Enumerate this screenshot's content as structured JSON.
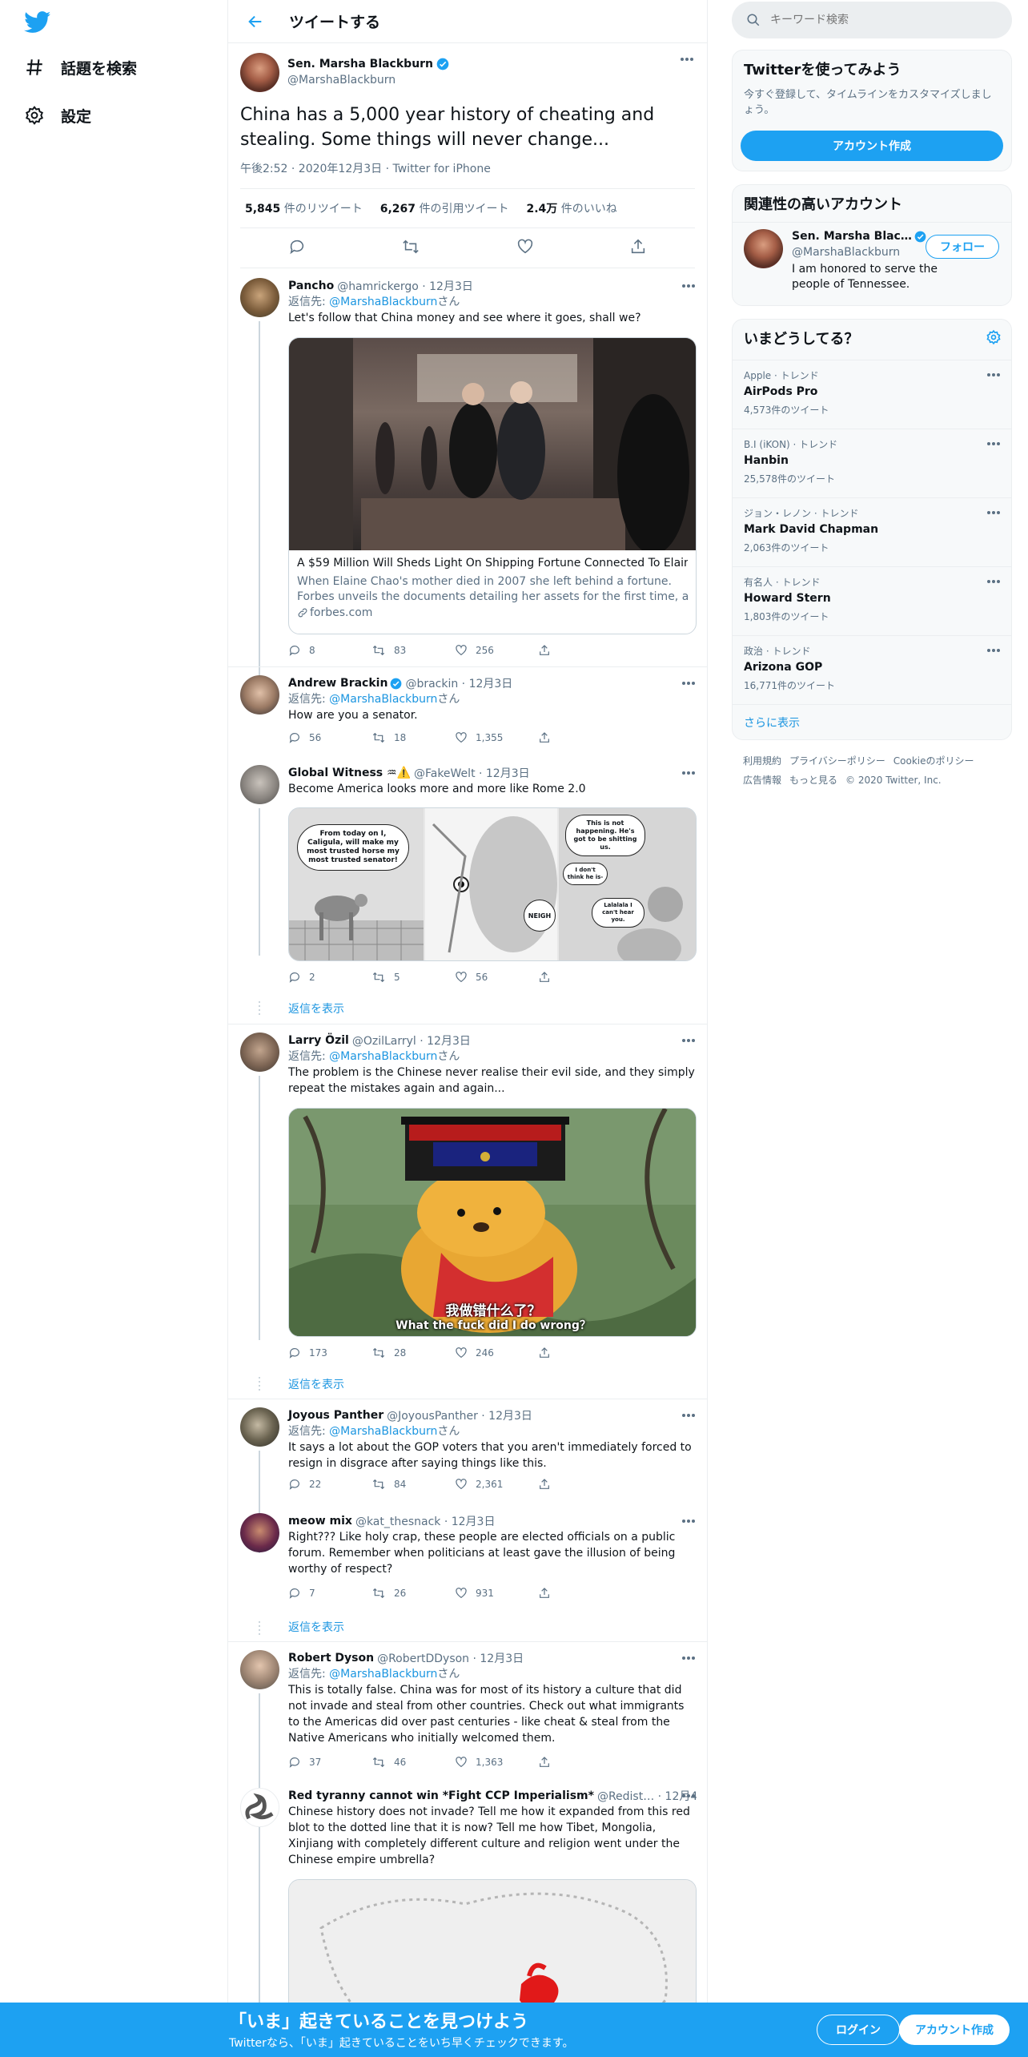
{
  "nav": {
    "items": [
      {
        "label": "話題を検索",
        "icon": "hashtag-icon"
      },
      {
        "label": "設定",
        "icon": "gear-icon"
      }
    ]
  },
  "header": {
    "title": "ツイートする"
  },
  "focal": {
    "name": "Sen. Marsha Blackburn",
    "handle": "@MarshaBlackburn",
    "text": "China has a 5,000 year history of cheating and stealing. Some things will never change...",
    "meta": "午後2:52 · 2020年12月3日 · Twitter for iPhone",
    "stats": [
      {
        "num": "5,845",
        "label": " 件のリツイート"
      },
      {
        "num": "6,267",
        "label": " 件の引用ツイート"
      },
      {
        "num": "2.4万",
        "label": " 件のいいね"
      }
    ]
  },
  "reply_prefix": "返信先: ",
  "reply_handle": "@MarshaBlackburn",
  "reply_suffix": "さん",
  "show_replies": "返信を表示",
  "tweets": [
    {
      "name": "Pancho",
      "handle": "@hamrickergo · 12月3日",
      "text": "Let's follow that China money and see where it goes, shall we?",
      "replies": "8",
      "retweets": "83",
      "likes": "256",
      "card": {
        "title": "A $59 Million Will Sheds Light On Shipping Fortune Connected To Elain…",
        "desc1": "When Elaine Chao's mother died in 2007 she left behind a fortune.",
        "desc2": "Forbes unveils the documents detailing her assets for the first time, as…",
        "domain": "forbes.com"
      }
    },
    {
      "name": "Andrew Brackin",
      "handle": "@brackin · 12月3日",
      "text": "How are you a senator.",
      "replies": "56",
      "retweets": "18",
      "likes": "1,355"
    },
    {
      "name": "Global Witness ♒⚠️",
      "handle": "@FakeWelt · 12月3日",
      "text": "Become America looks more and more like Rome 2.0",
      "replies": "2",
      "retweets": "5",
      "likes": "56",
      "comic": {
        "b1": "From today on I, Caligula, will make my most trusted horse my most trusted senator!",
        "b2": "NEIGH",
        "b3": "This is not happening. He's got to be shitting us.",
        "b4": "I don't think he is-",
        "b5": "Lalalala I can't hear you."
      }
    },
    {
      "name": "Larry Özil",
      "handle": "@OzilLarryl · 12月3日",
      "text": "The problem is the Chinese never realise their evil side, and they simply repeat the mistakes again and again...",
      "replies": "173",
      "retweets": "28",
      "likes": "246",
      "meme": {
        "cn": "我做错什么了？",
        "en": "What the fuck did I do wrong？"
      }
    },
    {
      "name": "Joyous Panther",
      "handle": "@JoyousPanther · 12月3日",
      "text": "It says a lot about the GOP voters that you aren't immediately forced to resign in disgrace after saying things like this.",
      "replies": "22",
      "retweets": "84",
      "likes": "2,361"
    },
    {
      "name": "meow mix",
      "handle": "@kat_thesnack · 12月3日",
      "text": "Right??? Like holy crap, these people are elected officials on a public forum. Remember when politicians at least gave the illusion of being worthy of respect?",
      "replies": "7",
      "retweets": "26",
      "likes": "931"
    },
    {
      "name": "Robert Dyson",
      "handle": "@RobertDDyson · 12月3日",
      "text": "This is totally false. China was for most of its history a culture that did not invade and steal from other countries. Check out what immigrants to the Americas did over past centuries - like cheat & steal from the Native Americans who initially welcomed them.",
      "replies": "37",
      "retweets": "46",
      "likes": "1,363"
    },
    {
      "name": "Red tyranny cannot win *Fight CCP Imperialism*",
      "handle": "@Redist… · 12月4日",
      "text": "Chinese history does not invade? Tell me how  it expanded from this red blot to the dotted line that it is now? Tell me how Tibet, Mongolia, Xinjiang with completely different culture and religion went under the Chinese empire umbrella?"
    }
  ],
  "sidebar": {
    "search_placeholder": "キーワード検索",
    "signup_box": {
      "title": "Twitterを使ってみよう",
      "sub": "今すぐ登録して、タイムラインをカスタマイズしましょう。",
      "button": "アカウント作成"
    },
    "related": {
      "title": "関連性の高いアカウント",
      "name": "Sen. Marsha Blac…",
      "handle": "@MarshaBlackburn",
      "follow": "フォロー",
      "bio": "I am honored to serve the people of Tennessee."
    },
    "trends_title": "いまどうしてる？",
    "trends": [
      {
        "ctx": "Apple · トレンド",
        "name": "AirPods Pro",
        "count": "4,573件のツイート"
      },
      {
        "ctx": "B.I (iKON) · トレンド",
        "name": "Hanbin",
        "count": "25,578件のツイート"
      },
      {
        "ctx": "ジョン・レノン · トレンド",
        "name": "Mark David Chapman",
        "count": "2,063件のツイート"
      },
      {
        "ctx": "有名人 · トレンド",
        "name": "Howard Stern",
        "count": "1,803件のツイート"
      },
      {
        "ctx": "政治 · トレンド",
        "name": "Arizona GOP",
        "count": "16,771件のツイート"
      }
    ],
    "show_more": "さらに表示",
    "footer": {
      "l1": "利用規約",
      "l2": "プライバシーポリシー",
      "l3": "Cookieのポリシー",
      "l4": "広告情報",
      "l5": "もっと見る",
      "copy": "© 2020 Twitter, Inc."
    }
  },
  "bottom": {
    "title": "「いま」起きていることを見つけよう",
    "sub": "Twitterなら、「いま」起きていることをいち早くチェックできます。",
    "login": "ログイン",
    "signup": "アカウント作成"
  },
  "colors": {
    "accent": "#1da1f2",
    "link": "#1b95e0",
    "secondary_text": "#5b7083",
    "border": "#ebeef0"
  }
}
